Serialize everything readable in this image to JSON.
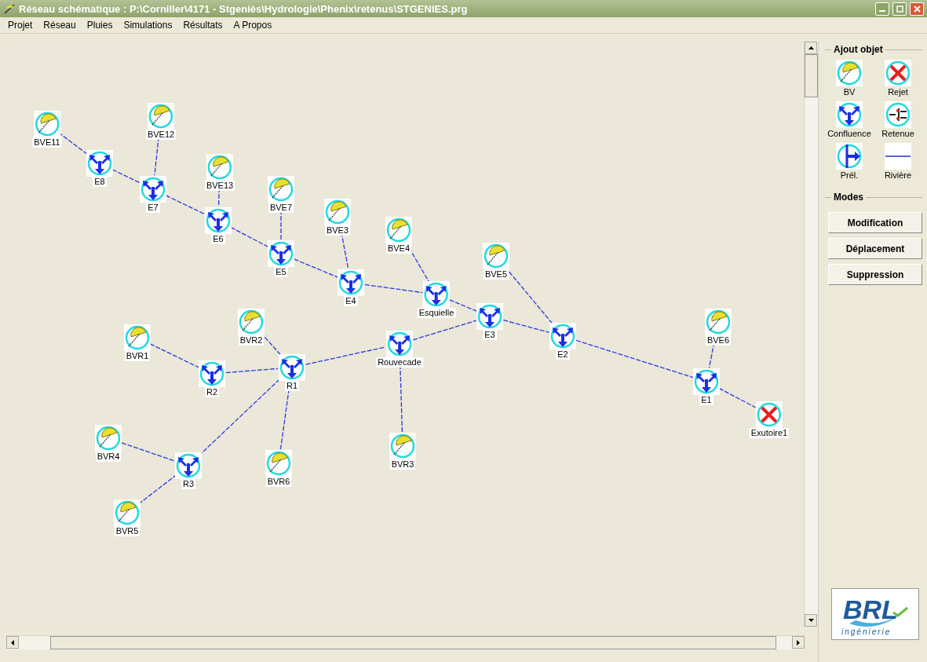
{
  "window": {
    "title": "Réseau schématique : P:\\Corniller\\4171 - Stgeniès\\Hydrologie\\Phenix\\retenus\\STGENIES.prg"
  },
  "menu": [
    "Projet",
    "Réseau",
    "Pluies",
    "Simulations",
    "Résultats",
    "A Propos"
  ],
  "network": {
    "nodes": [
      {
        "label": "BVE11",
        "kind": "bv"
      },
      {
        "label": "BVE12",
        "kind": "bv"
      },
      {
        "label": "E8",
        "kind": "confluence"
      },
      {
        "label": "E7",
        "kind": "confluence"
      },
      {
        "label": "BVE13",
        "kind": "bv"
      },
      {
        "label": "E6",
        "kind": "confluence"
      },
      {
        "label": "BVE7",
        "kind": "bv"
      },
      {
        "label": "E5",
        "kind": "confluence"
      },
      {
        "label": "BVE3",
        "kind": "bv"
      },
      {
        "label": "E4",
        "kind": "confluence"
      },
      {
        "label": "BVE4",
        "kind": "bv"
      },
      {
        "label": "Esquielle",
        "kind": "confluence"
      },
      {
        "label": "BVE5",
        "kind": "bv"
      },
      {
        "label": "E3",
        "kind": "confluence"
      },
      {
        "label": "E2",
        "kind": "confluence"
      },
      {
        "label": "BVR2",
        "kind": "bv"
      },
      {
        "label": "BVR1",
        "kind": "bv"
      },
      {
        "label": "Rouvecade",
        "kind": "confluence"
      },
      {
        "label": "R1",
        "kind": "confluence"
      },
      {
        "label": "R2",
        "kind": "confluence"
      },
      {
        "label": "BVE6",
        "kind": "bv"
      },
      {
        "label": "E1",
        "kind": "confluence"
      },
      {
        "label": "Exutoire1",
        "kind": "rejet"
      },
      {
        "label": "BVR4",
        "kind": "bv"
      },
      {
        "label": "BVR3",
        "kind": "bv"
      },
      {
        "label": "BVR6",
        "kind": "bv"
      },
      {
        "label": "R3",
        "kind": "confluence"
      },
      {
        "label": "BVR5",
        "kind": "bv"
      }
    ]
  },
  "panel": {
    "add_group": {
      "title": "Ajout objet",
      "items": [
        {
          "label": "BV",
          "kind": "bv"
        },
        {
          "label": "Rejet",
          "kind": "rejet"
        },
        {
          "label": "Confluence",
          "kind": "confluence"
        },
        {
          "label": "Retenue",
          "kind": "retenue"
        },
        {
          "label": "Prél.",
          "kind": "prelevement"
        },
        {
          "label": "Rivière",
          "kind": "riviere"
        }
      ]
    },
    "modes_group": {
      "title": "Modes",
      "buttons": [
        "Modification",
        "Déplacement",
        "Suppression"
      ]
    },
    "logo": {
      "name": "BRL",
      "tagline": "ingénierie"
    }
  }
}
